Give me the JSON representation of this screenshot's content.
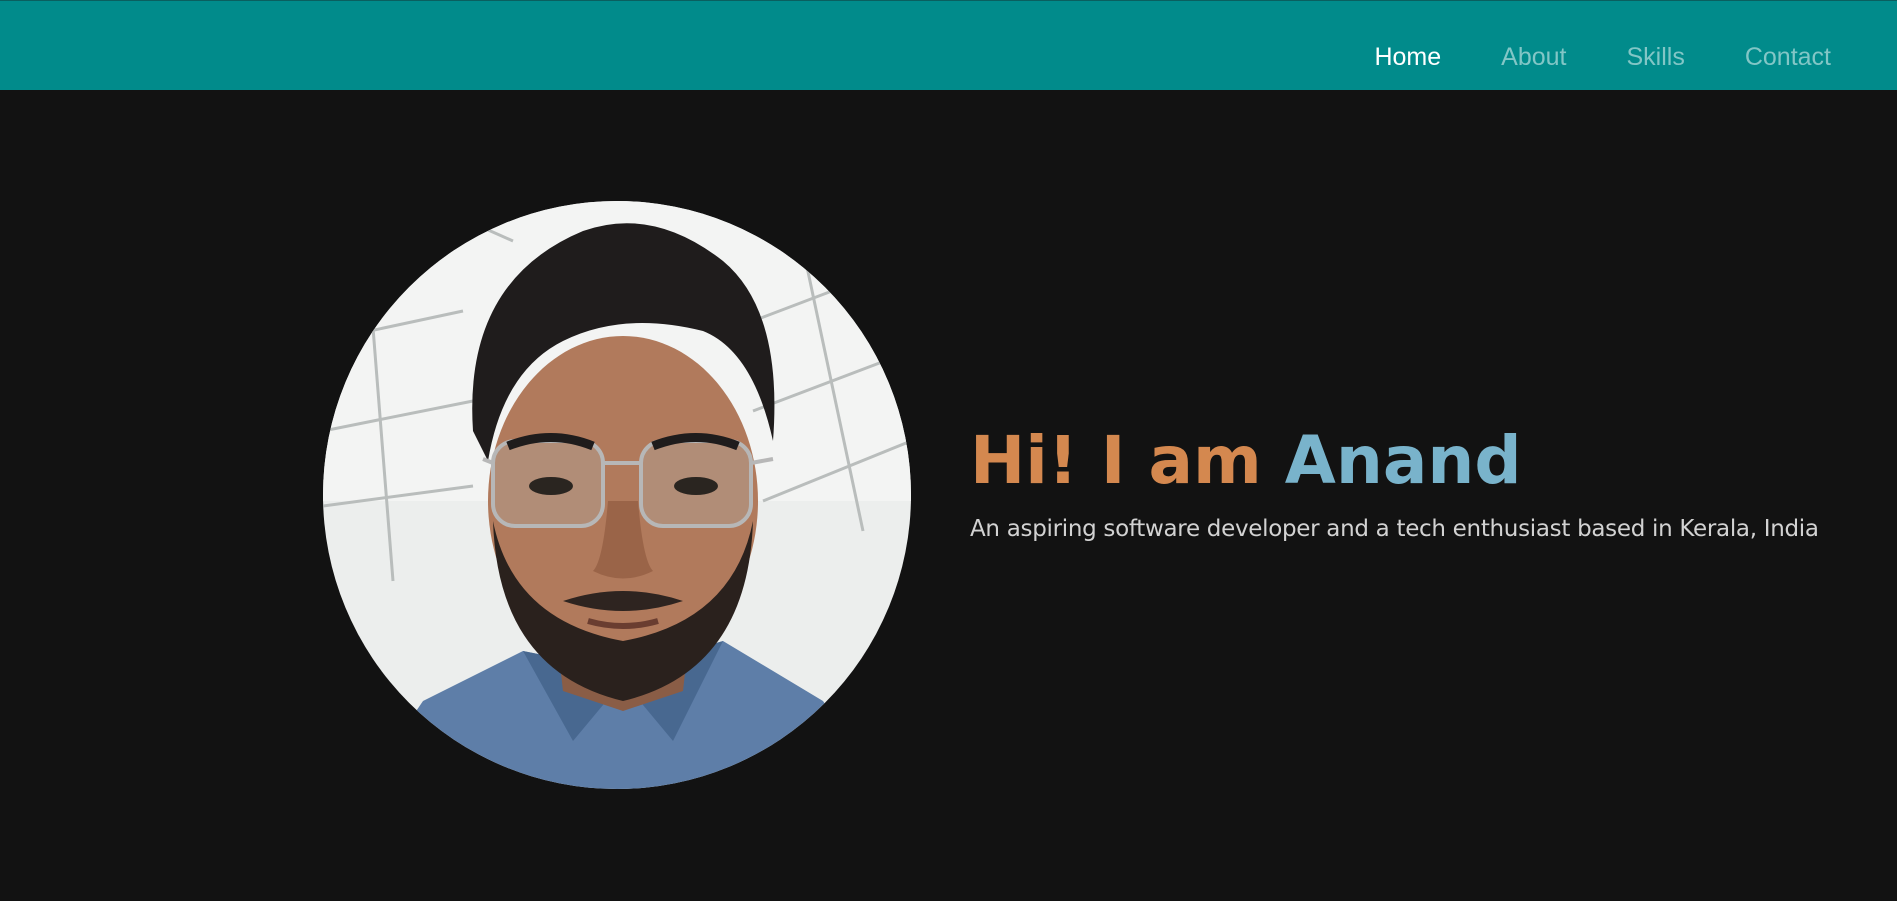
{
  "nav": {
    "items": [
      {
        "label": "Home",
        "active": true
      },
      {
        "label": "About",
        "active": false
      },
      {
        "label": "Skills",
        "active": false
      },
      {
        "label": "Contact",
        "active": false
      }
    ]
  },
  "hero": {
    "greeting": "Hi! I am",
    "name": "Anand",
    "tagline": "An aspiring software developer and a tech enthusiast based in Kerala, India"
  },
  "colors": {
    "navbar": "#018b8b",
    "background": "#121212",
    "greeting": "#d4884f",
    "name": "#79b3cb",
    "nav_active": "#ffffff",
    "nav_inactive": "#82c6c6"
  }
}
